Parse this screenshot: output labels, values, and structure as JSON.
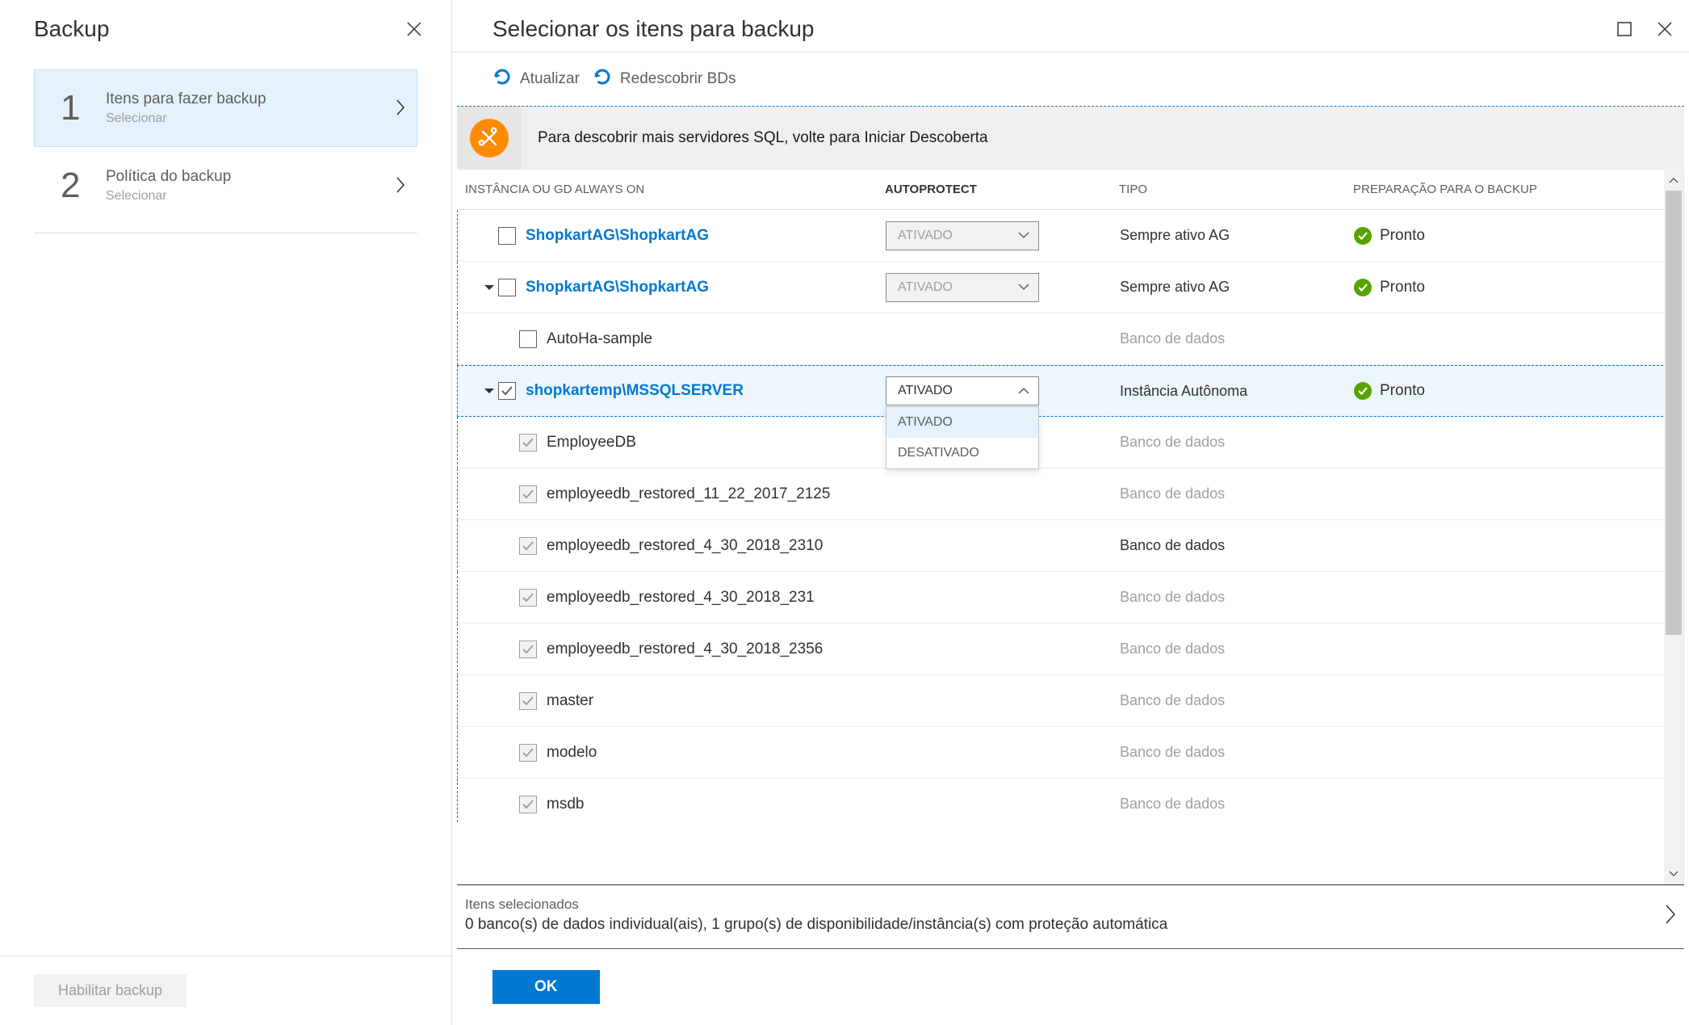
{
  "left": {
    "title": "Backup",
    "steps": [
      {
        "num": "1",
        "label": "Itens para fazer backup",
        "sub": "Selecionar"
      },
      {
        "num": "2",
        "label": "Política do backup",
        "sub": "Selecionar"
      }
    ],
    "enable_button": "Habilitar backup"
  },
  "right": {
    "title": "Selecionar os itens para backup",
    "toolbar": {
      "refresh": "Atualizar",
      "rediscover": "Redescobrir BDs"
    },
    "info_text": "Para descobrir mais servidores SQL, volte para Iniciar Descoberta",
    "columns": {
      "instance": "INSTÂNCIA OU GD ALWAYS ON",
      "autoprotect": "AUTOPROTECT",
      "type": "TIPO",
      "readiness": "PREPARAÇÃO PARA O BACKUP"
    },
    "autoprotect_menu": {
      "selected": "ATIVADO",
      "options": [
        "ATIVADO",
        "DESATIVADO"
      ]
    },
    "rows": [
      {
        "name": "ShopkartAG\\ShopkartAG",
        "indent": 0,
        "checked": false,
        "disabled": false,
        "link": true,
        "expander": "none",
        "autoprotect": "ATIVADO",
        "autoprotect_disabled": true,
        "type": "Sempre ativo AG",
        "type_disabled": false,
        "ready": true
      },
      {
        "name": "ShopkartAG\\ShopkartAG",
        "indent": 0,
        "checked": false,
        "disabled": false,
        "link": true,
        "expander": "expanded",
        "autoprotect": "ATIVADO",
        "autoprotect_disabled": true,
        "type": "Sempre ativo AG",
        "type_disabled": false,
        "ready": true
      },
      {
        "name": "AutoHa-sample",
        "indent": 1,
        "checked": false,
        "disabled": false,
        "link": false,
        "expander": "none",
        "autoprotect": null,
        "type": "Banco de dados",
        "type_disabled": true,
        "ready": false
      },
      {
        "name": "shopkartemp\\MSSQLSERVER",
        "indent": 0,
        "checked": true,
        "disabled": false,
        "link": true,
        "expander": "expanded",
        "autoprotect": "ATIVADO",
        "autoprotect_disabled": false,
        "dropdown_open": true,
        "type": "Instância Autônoma",
        "type_disabled": false,
        "ready": true,
        "selected": true
      },
      {
        "name": "EmployeeDB",
        "indent": 1,
        "checked": true,
        "disabled": true,
        "link": false,
        "expander": "none",
        "autoprotect": null,
        "type": "Banco de dados",
        "type_disabled": true,
        "ready": false
      },
      {
        "name": "employeedb_restored_11_22_2017_2125",
        "indent": 1,
        "checked": true,
        "disabled": true,
        "link": false,
        "expander": "none",
        "autoprotect": null,
        "type": "Banco de dados",
        "type_disabled": true,
        "ready": false
      },
      {
        "name": "employeedb_restored_4_30_2018_2310",
        "indent": 1,
        "checked": true,
        "disabled": true,
        "link": false,
        "expander": "none",
        "autoprotect": null,
        "type": "Banco de dados",
        "type_disabled": false,
        "ready": false
      },
      {
        "name": "employeedb_restored_4_30_2018_231",
        "indent": 1,
        "checked": true,
        "disabled": true,
        "link": false,
        "expander": "none",
        "autoprotect": null,
        "type": "Banco de dados",
        "type_disabled": true,
        "ready": false
      },
      {
        "name": "employeedb_restored_4_30_2018_2356",
        "indent": 1,
        "checked": true,
        "disabled": true,
        "link": false,
        "expander": "none",
        "autoprotect": null,
        "type": "Banco de dados",
        "type_disabled": true,
        "ready": false
      },
      {
        "name": "master",
        "indent": 1,
        "checked": true,
        "disabled": true,
        "link": false,
        "expander": "none",
        "autoprotect": null,
        "type": "Banco de dados",
        "type_disabled": true,
        "ready": false
      },
      {
        "name": "modelo",
        "indent": 1,
        "checked": true,
        "disabled": true,
        "link": false,
        "expander": "none",
        "autoprotect": null,
        "type": "Banco de dados",
        "type_disabled": true,
        "ready": false
      },
      {
        "name": "msdb",
        "indent": 1,
        "checked": true,
        "disabled": true,
        "link": false,
        "expander": "none",
        "autoprotect": null,
        "type": "Banco de dados",
        "type_disabled": true,
        "ready": false
      }
    ],
    "selected_bar": {
      "label": "Itens selecionados",
      "value": "0 banco(s) de dados individual(ais), 1 grupo(s) de disponibilidade/instância(s) com proteção automática"
    },
    "readiness_ready": "Pronto",
    "ok_button": "OK"
  }
}
